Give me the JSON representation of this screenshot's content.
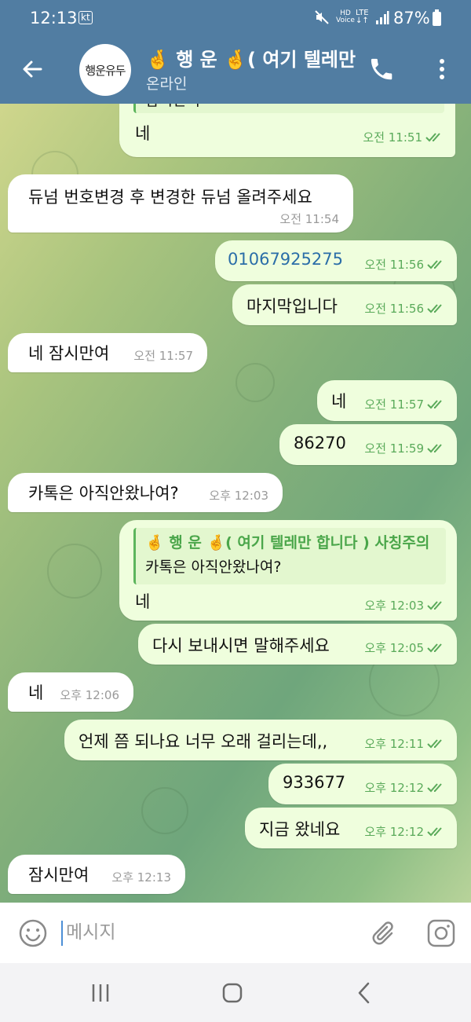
{
  "status_bar": {
    "time": "12:13",
    "carrier": "kt",
    "hd_voice": "HD\nVoice",
    "lte": "LTE",
    "battery": "87%"
  },
  "header": {
    "avatar_text": "행운유두",
    "title": "🤞 행 운 🤞( 여기 텔레만 합니다 ) 사칭주의",
    "status": "온라인"
  },
  "messages": [
    {
      "dir": "out",
      "reply_text": "잠시만여",
      "text": "네",
      "time": "오전 11:51",
      "read": true
    },
    {
      "dir": "in",
      "text": "듀넘 번호변경 후 변경한 듀넘 올려주세요",
      "time": "오전 11:54"
    },
    {
      "dir": "out",
      "text": "01067925275",
      "link": true,
      "time": "오전 11:56",
      "read": true
    },
    {
      "dir": "out",
      "text": "마지막입니다",
      "time": "오전 11:56",
      "read": true
    },
    {
      "dir": "in",
      "text": "네 잠시만여",
      "time": "오전 11:57"
    },
    {
      "dir": "out",
      "text": "네",
      "time": "오전 11:57",
      "read": true
    },
    {
      "dir": "out",
      "text": "86270",
      "time": "오전 11:59",
      "read": true
    },
    {
      "dir": "in",
      "text": "카톡은 아직안왔나여?",
      "time": "오후 12:03"
    },
    {
      "dir": "out",
      "reply_name": "🤞 행 운 🤞( 여기 텔레만 합니다 ) 사칭주의",
      "reply_text": "카톡은 아직안왔나여?",
      "text": "네",
      "time": "오후 12:03",
      "read": true
    },
    {
      "dir": "out",
      "text": "다시 보내시면 말해주세요",
      "time": "오후 12:05",
      "read": true
    },
    {
      "dir": "in",
      "text": "네",
      "time": "오후 12:06"
    },
    {
      "dir": "out",
      "text": "언제 쯤 되나요 너무 오래 걸리는데,,",
      "time": "오후 12:11",
      "read": true
    },
    {
      "dir": "out",
      "text": "933677",
      "time": "오후 12:12",
      "read": true
    },
    {
      "dir": "out",
      "text": "지금 왔네요",
      "time": "오후 12:12",
      "read": true
    },
    {
      "dir": "in",
      "text": "잠시만여",
      "time": "오후 12:13"
    }
  ],
  "composer": {
    "placeholder": "메시지"
  },
  "icons": {
    "back": "arrow-left-icon",
    "call": "phone-icon",
    "more": "more-vertical-icon",
    "emoji": "smiley-icon",
    "attach": "paperclip-icon",
    "camera": "instagram-camera-icon",
    "read_receipt": "double-check-icon",
    "nav_recent": "recent-apps-icon",
    "nav_home": "home-icon",
    "nav_back": "nav-back-icon"
  },
  "colors": {
    "header": "#517da2",
    "outgoing_bubble": "#effedd",
    "incoming_bubble": "#ffffff",
    "link": "#2b6ea8",
    "check": "#5aaa5a"
  }
}
